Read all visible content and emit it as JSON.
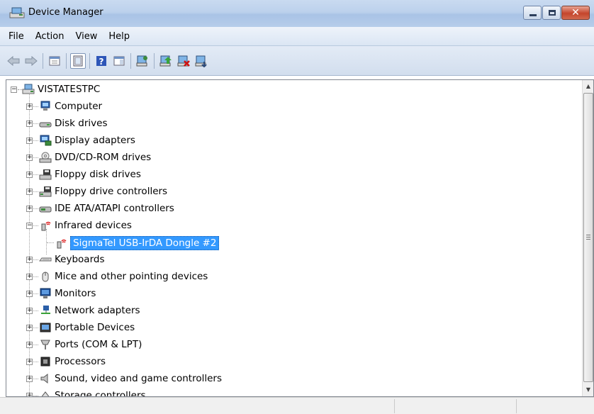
{
  "window": {
    "title": "Device Manager",
    "close_glyph": "✕"
  },
  "menu": [
    "File",
    "Action",
    "View",
    "Help"
  ],
  "toolbar": {
    "icons": [
      "back-arrow-icon",
      "forward-arrow-icon",
      "properties-icon",
      "show-console-tree-icon",
      "help-icon",
      "action-pane-icon",
      "scan-hardware-icon",
      "update-driver-icon",
      "uninstall-icon",
      "disable-icon"
    ]
  },
  "tree": {
    "root": "VISTATESTPC",
    "categories": [
      "Computer",
      "Disk drives",
      "Display adapters",
      "DVD/CD-ROM drives",
      "Floppy disk drives",
      "Floppy drive controllers",
      "IDE ATA/ATAPI controllers",
      "Infrared devices",
      "Keyboards",
      "Mice and other pointing devices",
      "Monitors",
      "Network adapters",
      "Portable Devices",
      "Ports (COM & LPT)",
      "Processors",
      "Sound, video and game controllers",
      "Storage controllers"
    ],
    "selected_child": "SigmaTel USB-IrDA Dongle #2",
    "expander_plus": "+",
    "expander_minus": "−"
  },
  "colors": {
    "selection": "#3399ff",
    "title_bar": "#bcd1ec"
  }
}
